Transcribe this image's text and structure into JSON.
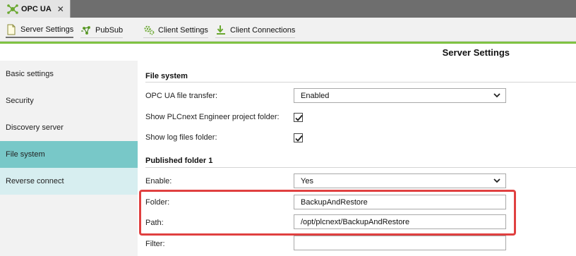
{
  "tab": {
    "title": "OPC UA",
    "close": "✕"
  },
  "toolbar": {
    "server_settings": "Server Settings",
    "pubsub": "PubSub",
    "client_settings": "Client Settings",
    "client_connections": "Client Connections"
  },
  "page_title": "Server Settings",
  "nav": [
    "Basic settings",
    "Security",
    "Discovery server",
    "File system",
    "Reverse connect"
  ],
  "file_system": {
    "heading": "File system",
    "opcua_file_transfer": {
      "label": "OPC UA file transfer:",
      "value": "Enabled"
    },
    "show_engineer_folder": {
      "label": "Show PLCnext Engineer project folder:",
      "checked": true
    },
    "show_log_folder": {
      "label": "Show log files folder:",
      "checked": true
    }
  },
  "published_folder": {
    "heading": "Published folder 1",
    "enable": {
      "label": "Enable:",
      "value": "Yes"
    },
    "folder": {
      "label": "Folder:",
      "value": "BackupAndRestore"
    },
    "path": {
      "label": "Path:",
      "value": "/opt/plcnext/BackupAndRestore"
    },
    "filter": {
      "label": "Filter:",
      "value": ""
    }
  },
  "colors": {
    "accent_green": "#7fc242",
    "nav_selected": "#78c8c8",
    "highlight": "#e04040"
  }
}
